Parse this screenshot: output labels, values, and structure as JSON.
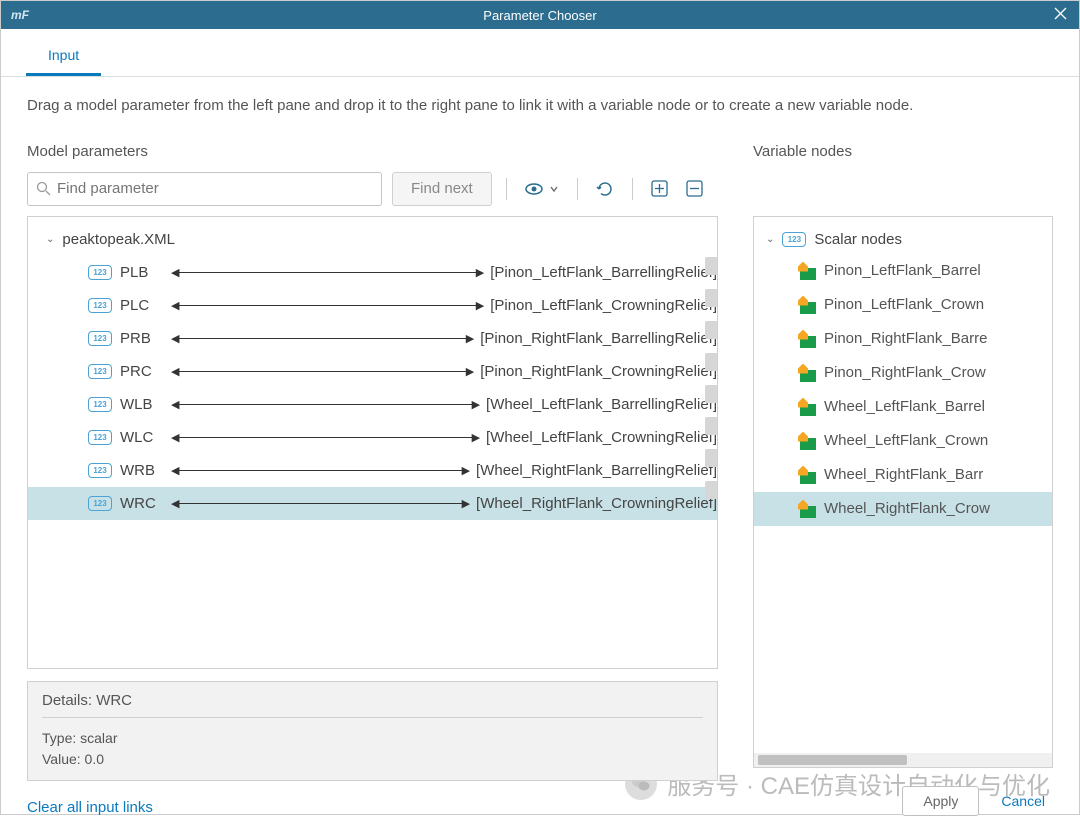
{
  "titlebar": {
    "logo": "mF",
    "title": "Parameter Chooser"
  },
  "tabs": {
    "input": "Input"
  },
  "instruction": "Drag a model parameter from the left pane and drop it to the right pane to link it with a variable node or to create a new variable node.",
  "leftPane": {
    "heading": "Model parameters",
    "searchPlaceholder": "Find parameter",
    "findNext": "Find next",
    "rootFile": "peaktopeak.XML",
    "params": [
      {
        "name": "PLB",
        "link": "[Pinon_LeftFlank_BarrellingRelief]",
        "selected": false
      },
      {
        "name": "PLC",
        "link": "[Pinon_LeftFlank_CrowningRelief]",
        "selected": false
      },
      {
        "name": "PRB",
        "link": "[Pinon_RightFlank_BarrellingRelief]",
        "selected": false
      },
      {
        "name": "PRC",
        "link": "[Pinon_RightFlank_CrowningRelief]",
        "selected": false
      },
      {
        "name": "WLB",
        "link": "[Wheel_LeftFlank_BarrellingRelief]",
        "selected": false
      },
      {
        "name": "WLC",
        "link": "[Wheel_LeftFlank_CrowningRelief]",
        "selected": false
      },
      {
        "name": "WRB",
        "link": "[Wheel_RightFlank_BarrellingRelief]",
        "selected": false
      },
      {
        "name": "WRC",
        "link": "[Wheel_RightFlank_CrowningRelief]",
        "selected": true
      }
    ],
    "details": {
      "titlePrefix": "Details: ",
      "titleValue": "WRC",
      "typeLabel": "Type: ",
      "typeValue": "scalar",
      "valueLabel": "Value: ",
      "valueValue": "0.0"
    }
  },
  "rightPane": {
    "heading": "Variable nodes",
    "rootLabel": "Scalar nodes",
    "nodes": [
      {
        "label": "Pinon_LeftFlank_Barrel",
        "selected": false
      },
      {
        "label": "Pinon_LeftFlank_Crown",
        "selected": false
      },
      {
        "label": "Pinon_RightFlank_Barre",
        "selected": false
      },
      {
        "label": "Pinon_RightFlank_Crow",
        "selected": false
      },
      {
        "label": "Wheel_LeftFlank_Barrel",
        "selected": false
      },
      {
        "label": "Wheel_LeftFlank_Crown",
        "selected": false
      },
      {
        "label": "Wheel_RightFlank_Barr",
        "selected": false
      },
      {
        "label": "Wheel_RightFlank_Crow",
        "selected": true
      }
    ]
  },
  "footer": {
    "clearLinks": "Clear all input links",
    "apply": "Apply",
    "cancel": "Cancel"
  },
  "watermark": "服务号 · CAE仿真设计自动化与优化"
}
